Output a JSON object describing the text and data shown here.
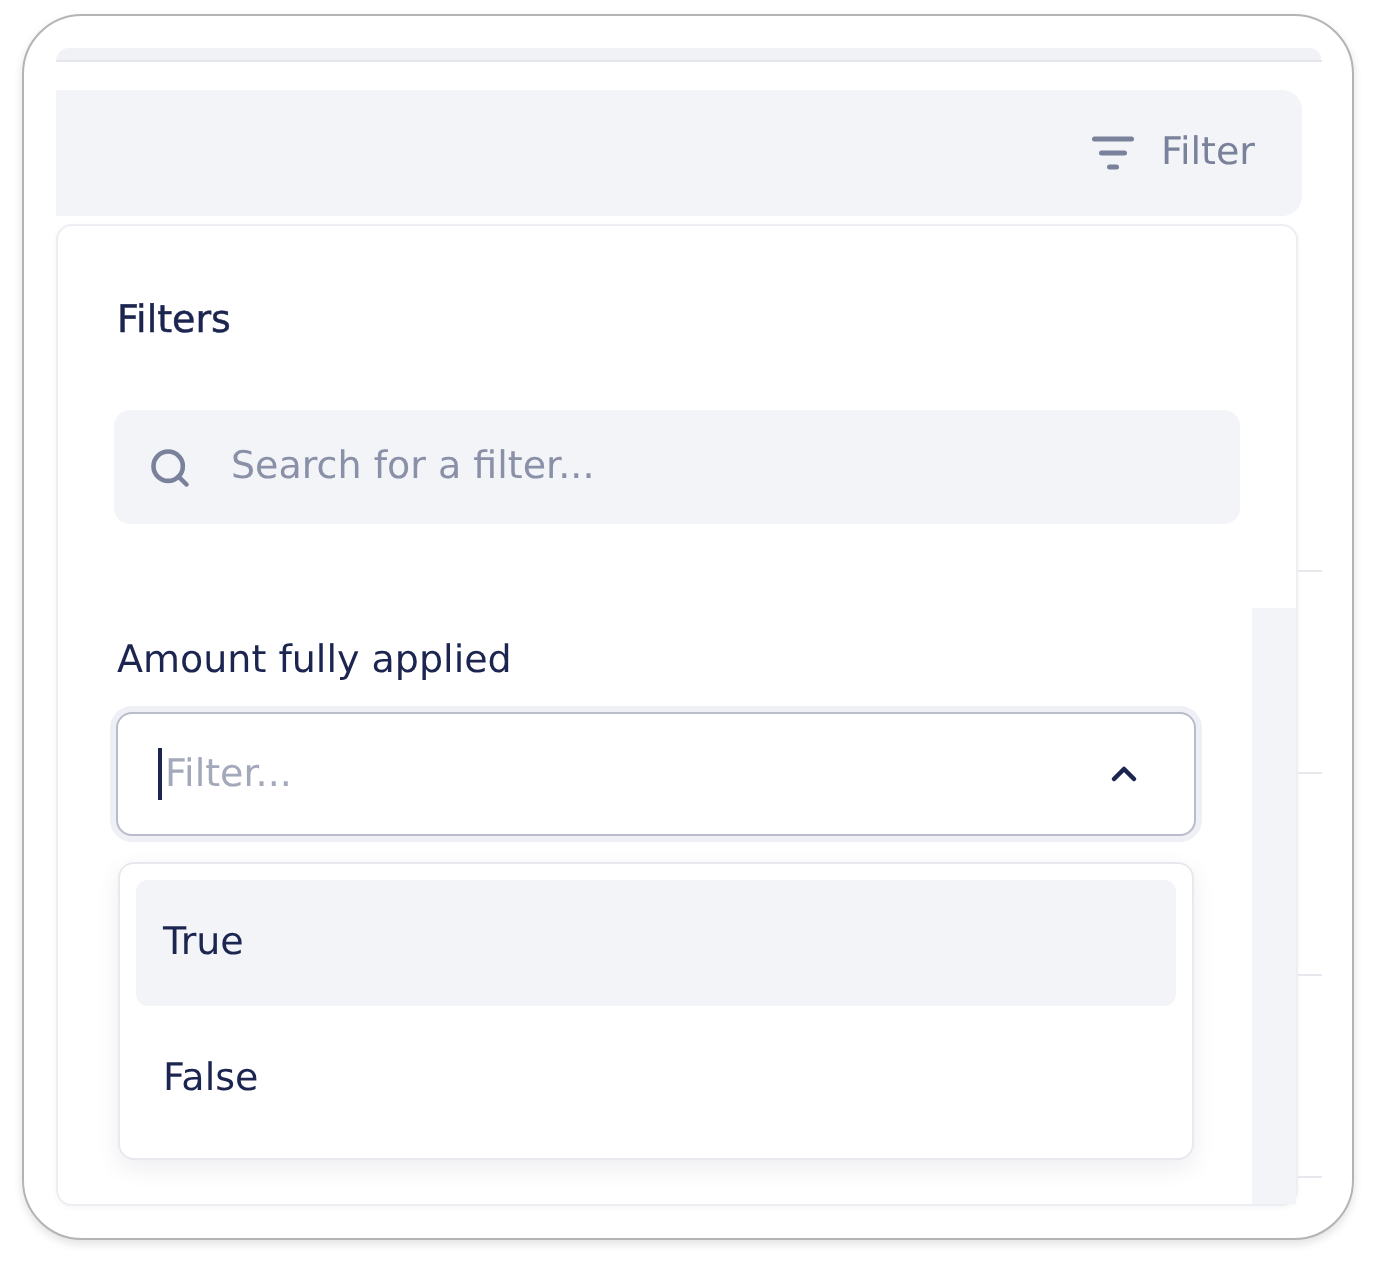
{
  "toolbar": {
    "filter_button": {
      "label": "Filter"
    }
  },
  "filter_panel": {
    "title": "Filters",
    "search": {
      "placeholder": "Search for a filter..."
    },
    "field": {
      "label": "Amount fully applied",
      "input": {
        "placeholder": "Filter...",
        "focused": true,
        "expanded": true
      },
      "options": [
        {
          "label": "True",
          "selected": true
        },
        {
          "label": "False",
          "selected": false
        }
      ]
    }
  }
}
